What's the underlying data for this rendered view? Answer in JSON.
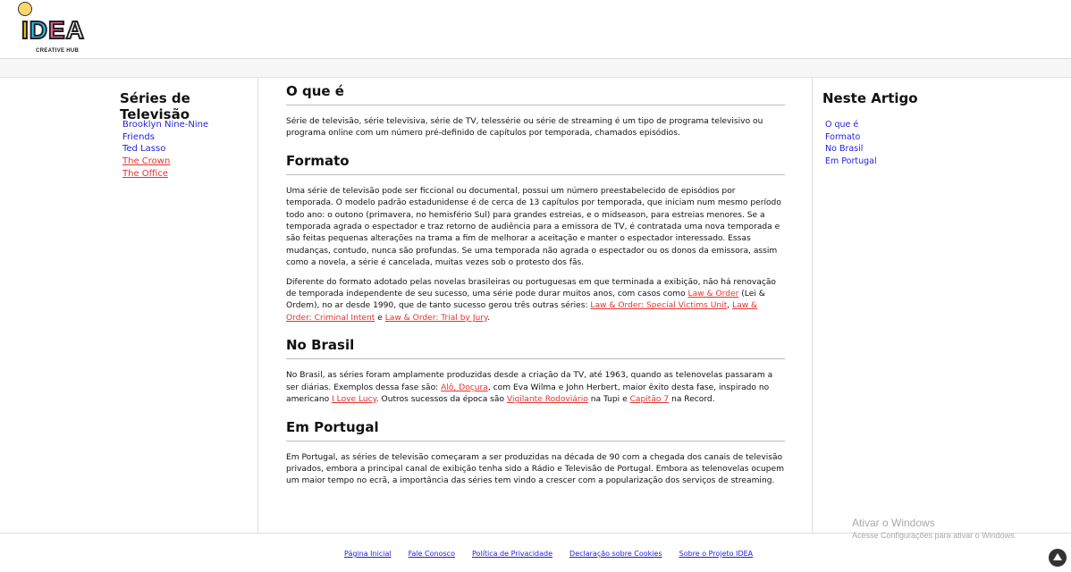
{
  "brand": {
    "name_i": "I",
    "name_d": "D",
    "name_e": "E",
    "name_a": "A",
    "subtitle": "CREATIVE HUB"
  },
  "left": {
    "title": "Séries de Televisão",
    "items": [
      {
        "label": "Brooklyn Nine-Nine",
        "state": "unvisited"
      },
      {
        "label": "Friends",
        "state": "unvisited"
      },
      {
        "label": "Ted Lasso",
        "state": "unvisited"
      },
      {
        "label": "The Crown",
        "state": "visited"
      },
      {
        "label": "The Office",
        "state": "visited"
      }
    ]
  },
  "article": {
    "s1": {
      "title": "O que é",
      "p1": "Série de televisão, série televisiva, série de TV, telessérie ou série de streaming é um tipo de programa televisivo ou programa online com um número pré-definido de capítulos por temporada, chamados episódios."
    },
    "s2": {
      "title": "Formato",
      "p1": "Uma série de televisão pode ser ficcional ou documental, possui um número preestabelecido de episódios por temporada. O modelo padrão estadunidense é de cerca de 13 capítulos por temporada, que iniciam num mesmo período todo ano: o outono (primavera, no hemisfério Sul) para grandes estreias, e o midseason, para estreias menores. Se a temporada agrada o espectador e traz retorno de audiência para a emissora de TV, é contratada uma nova temporada e são feitas pequenas alterações na trama a fim de melhorar a aceitação e manter o espectador interessado. Essas mudanças, contudo, nunca são profundas. Se uma temporada não agrada o espectador ou os donos da emissora, assim como a novela, a série é cancelada, muitas vezes sob o protesto dos fãs.",
      "p2a": "Diferente do formato adotado pelas novelas brasileiras ou portuguesas em que terminada a exibição, não há renovação de temporada independente de seu sucesso, uma série pode durar muitos anos, com casos como ",
      "link1": "Law & Order",
      "p2b": " (Lei & Ordem), no ar desde 1990, que de tanto sucesso gerou três outras séries: ",
      "link2": "Law & Order: Special Victims Unit",
      "p2c": ", ",
      "link3": "Law & Order: Criminal Intent",
      "p2d": " e ",
      "link4": "Law & Order: Trial by Jury",
      "p2e": "."
    },
    "s3": {
      "title": "No Brasil",
      "p1a": "No Brasil, as séries foram amplamente produzidas desde a criação da TV, até 1963, quando as telenovelas passaram a ser diárias. Exemplos dessa fase são: ",
      "link1": "Alô, Doçura",
      "p1b": ", com Eva Wilma e John Herbert, maior êxito desta fase, inspirado no americano ",
      "link2": "I Love Lucy",
      "p1c": ". Outros sucessos da época são ",
      "link3": "Vigilante Rodoviário",
      "p1d": " na Tupi e ",
      "link4": "Capitão 7",
      "p1e": " na Record."
    },
    "s4": {
      "title": "Em Portugal",
      "p1": "Em Portugal, as séries de televisão começaram a ser produzidas na década de 90 com a chegada dos canais de televisão privados, embora a principal canal de exibição tenha sido a Rádio e Televisão de Portugal. Embora as telenovelas ocupem um maior tempo no ecrã, a importância das séries tem vindo a crescer com a popularização dos serviços de streaming."
    }
  },
  "right": {
    "title": "Neste Artigo",
    "items": [
      "O que é",
      "Formato",
      "No Brasil",
      "Em Portugal"
    ]
  },
  "footer": {
    "links": [
      "Página Inicial",
      "Fale Conosco",
      "Política de Privacidade",
      "Declaração sobre Cookies",
      "Sobre o Projeto IDEA"
    ]
  },
  "watermark": {
    "line1": "Ativar o Windows",
    "line2": "Acesse Configurações para ativar o Windows."
  }
}
